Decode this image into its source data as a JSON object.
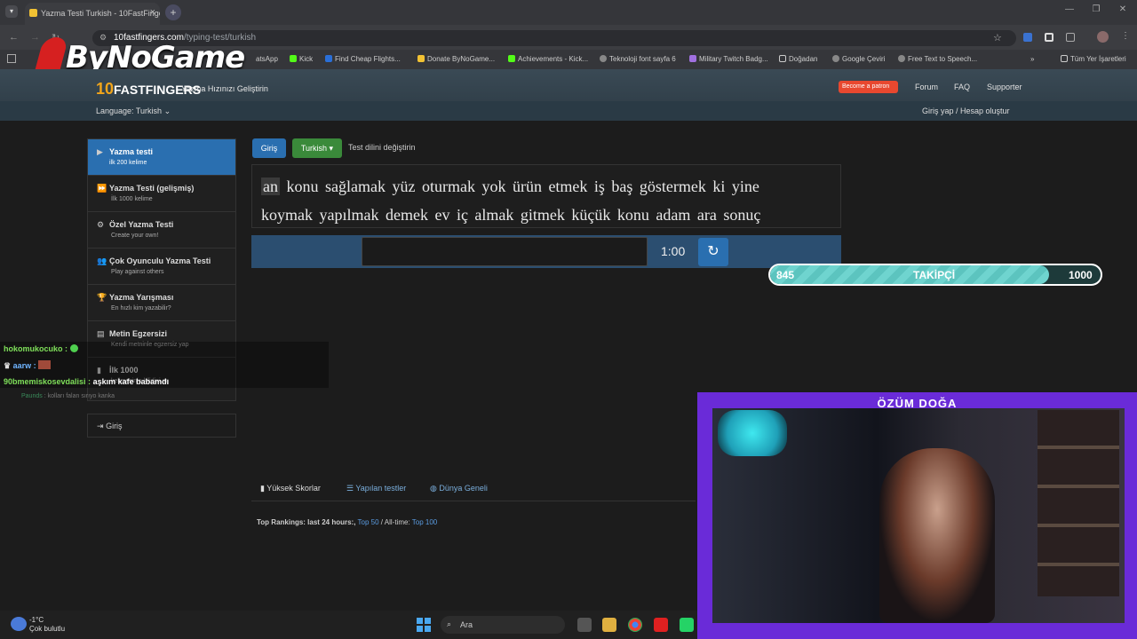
{
  "browser": {
    "tab_title": "Yazma Testi Turkish - 10FastFingers",
    "url_host": "10fastfingers.com",
    "url_path": "/typing-test/turkish",
    "bookmarks": [
      "atsApp",
      "Kick",
      "Find Cheap Flights...",
      "Donate ByNoGame...",
      "Achievements - Kick...",
      "Teknoloji font sayfa 6",
      "Military Twitch Badg...",
      "Doğadan",
      "Google Çeviri",
      "Free Text to Speech...",
      "Tüm Yer İşaretleri"
    ]
  },
  "overlay": {
    "logo_text": "ByNoGame"
  },
  "site": {
    "brand": "FASTFINGERS",
    "brand_prefix": "10",
    "tagline": "Yazma Hızınızı Geliştirin",
    "patron_label": "Become a patron",
    "nav": [
      "Forum",
      "FAQ",
      "Supporter"
    ],
    "language_label": "Language: Turkish",
    "login_label": "Giriş yap / Hesap oluştur"
  },
  "sidebar": {
    "items": [
      {
        "title": "Yazma testi",
        "subtitle": "ilk 200 kelime"
      },
      {
        "title": "Yazma Testi (gelişmiş)",
        "subtitle": "İlk 1000 kelime"
      },
      {
        "title": "Özel Yazma Testi",
        "subtitle": "Create your own!"
      },
      {
        "title": "Çok Oyunculu Yazma Testi",
        "subtitle": "Play against others"
      },
      {
        "title": "Yazma Yarışması",
        "subtitle": "En hızlı kim yazabilir?"
      },
      {
        "title": "Metin Egzersizi",
        "subtitle": "Kendi metninle egzersiz yap"
      },
      {
        "title": "İlk 1000",
        "subtitle": "kelimesinin kilidini aç"
      }
    ],
    "giris_label": "Giriş"
  },
  "test": {
    "giris_button": "Giriş",
    "lang_button": "Turkish ▾",
    "change_lang": "Test dilini değiştirin",
    "current_word": "an",
    "line1_rest": "konu sağlamak yüz oturmak yok ürün etmek iş baş göstermek ki yine",
    "line2": "koymak yapılmak demek ev iç almak gitmek küçük konu adam ara sonuç",
    "timer": "1:00"
  },
  "follower_goal": {
    "current": "845",
    "label": "TAKİPÇİ",
    "goal": "1000",
    "progress": 0.845
  },
  "chat": [
    {
      "user": "hokomukocuko :",
      "text": "",
      "color": "#7fe05a"
    },
    {
      "user": "aarw :",
      "text": "",
      "color": "#6fb4ff"
    },
    {
      "user": "90bmemiskosevdalisi :",
      "text": "aşkım kafe babamdı",
      "color": "#7fe05a"
    },
    {
      "user": "Paunds",
      "text": ": kolları falan sırıyo kanka",
      "color": "#3a8a5a"
    }
  ],
  "scores": {
    "tabs": [
      "Yüksek Skorlar",
      "Yapılan testler",
      "Dünya Geneli"
    ],
    "rankings_prefix": "Top Rankings: last 24 hours:,",
    "top50": "Top 50",
    "alltime": "/ All-time:",
    "top100": "Top 100"
  },
  "webcam": {
    "name": "ÖZÜM DOĞA"
  },
  "taskbar": {
    "temp": "-1°C",
    "weather": "Çok bulutlu",
    "search": "Ara"
  }
}
